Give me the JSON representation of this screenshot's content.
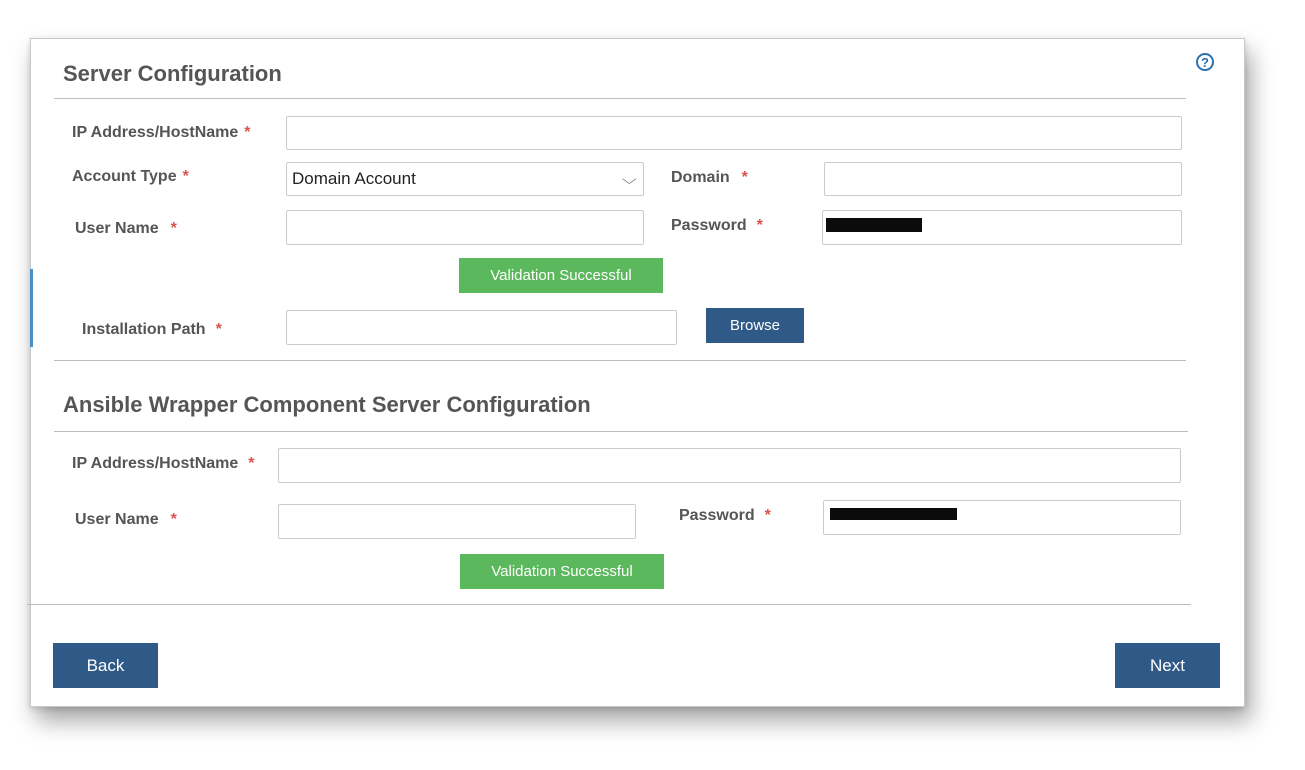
{
  "help": {
    "icon": "help-circle-icon",
    "glyph": "?"
  },
  "server_config": {
    "title": "Server Configuration",
    "ip_label": "IP Address/HostName",
    "ip_value": "",
    "account_type_label": "Account Type",
    "account_type_value": "Domain Account",
    "domain_label": "Domain",
    "domain_value": "",
    "username_label": "User Name",
    "username_value": "",
    "password_label": "Password",
    "validation_label": "Validation Successful",
    "install_path_label": "Installation Path",
    "install_path_value": "",
    "browse_label": "Browse"
  },
  "ansible_config": {
    "title": "Ansible Wrapper Component Server Configuration",
    "ip_label": "IP Address/HostName",
    "ip_value": "",
    "username_label": "User Name",
    "username_value": "",
    "password_label": "Password",
    "validation_label": "Validation Successful"
  },
  "required_marker": "*",
  "footer": {
    "back_label": "Back",
    "next_label": "Next"
  },
  "colors": {
    "primary": "#2f5a87",
    "success": "#5cb85c",
    "required": "#d9534f",
    "help": "#2e6fb0"
  }
}
